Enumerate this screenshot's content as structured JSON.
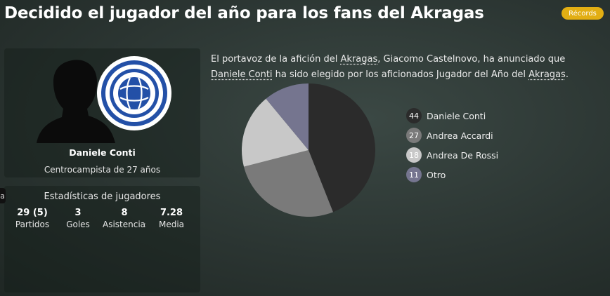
{
  "header": {
    "title": "Decidido el jugador del año para los fans del Akragas",
    "records_button": "Récords"
  },
  "player": {
    "name": "Daniele Conti",
    "role": "Centrocampista de 27 años"
  },
  "stats": {
    "title": "Estadísticas de jugadores",
    "items": [
      {
        "value": "29 (5)",
        "label": "Partidos"
      },
      {
        "value": "3",
        "label": "Goles"
      },
      {
        "value": "8",
        "label": "Asistencias"
      },
      {
        "value": "7.28",
        "label": "Media"
      }
    ]
  },
  "side_tab": "a",
  "announcement": {
    "t1": "El portavoz de la afición del ",
    "club": "Akragas",
    "t2": ", Giacomo Castelnovo, ha anunciado que ",
    "player": "Daniele Conti",
    "t3": " ha sido elegido por los aficionados Jugador del Año del ",
    "club2": "Akragas",
    "t4": "."
  },
  "chart_data": {
    "type": "pie",
    "categories": [
      "Daniele Conti",
      "Andrea Accardi",
      "Andrea De Rossi",
      "Otro"
    ],
    "values": [
      44,
      27,
      18,
      11
    ],
    "colors": [
      "#2b2b2b",
      "#7a7a7a",
      "#c8c8c8",
      "#75758f"
    ],
    "legend": "right"
  }
}
